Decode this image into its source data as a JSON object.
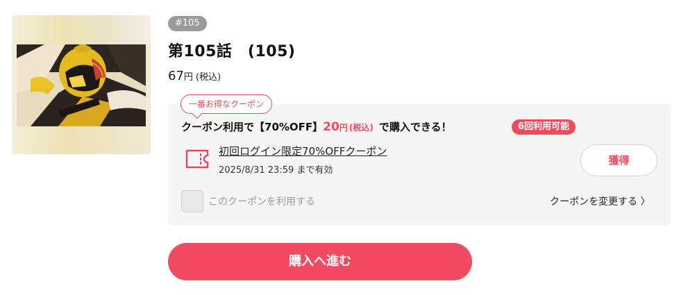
{
  "episode": {
    "badge": "#105",
    "title": "第105話　(105)",
    "price_value": "67",
    "price_unit": "円",
    "price_tax": "(税込)"
  },
  "coupon": {
    "best_tag": "一番お得なクーポン",
    "headline_prefix": "クーポン利用で【70%OFF】",
    "discounted_price": "20",
    "price_unit": "円",
    "price_tax": "(税込)",
    "headline_suffix": "で購入できる！",
    "uses_available": "6回利用可能",
    "name": "初回ログイン限定70%OFFクーポン",
    "expiry": "2025/8/31 23:59 まで有効",
    "get_label": "獲得",
    "use_checkbox_label": "このクーポンを利用する",
    "change_label": "クーポンを変更する",
    "change_chevron": "〉",
    "accent_color": "#f2495e"
  },
  "purchase": {
    "label": "購入へ進む"
  }
}
